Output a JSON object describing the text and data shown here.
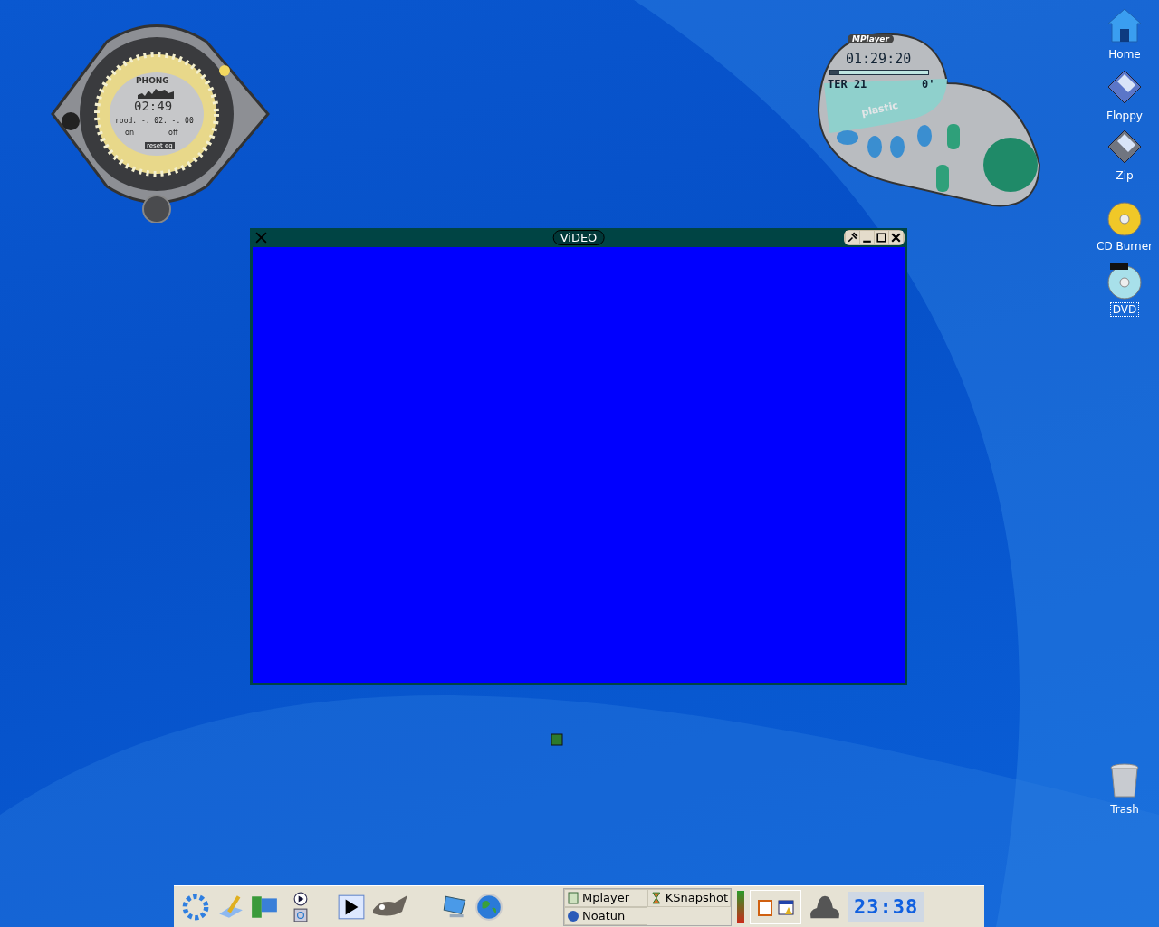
{
  "phong_player": {
    "title": "PHONG",
    "time": "02:49",
    "info": "rood. -. 02. -. 00",
    "on_label": "on",
    "off_label": "off",
    "reset_label": "reset eq"
  },
  "mplayer_skin": {
    "logo": "MPlayer",
    "time": "01:29:20",
    "track": "TER 21",
    "counter": "0'",
    "brand": "plastic",
    "level": 0.09
  },
  "desktop_icons": [
    {
      "label": "Home",
      "kind": "home",
      "selected": false
    },
    {
      "label": "Floppy",
      "kind": "floppy",
      "selected": false
    },
    {
      "label": "Zip",
      "kind": "zip",
      "selected": false
    },
    {
      "label": "CD Burner",
      "kind": "cd",
      "selected": false
    },
    {
      "label": "DVD",
      "kind": "dvd",
      "selected": true
    }
  ],
  "video_window": {
    "title": "ViDEO"
  },
  "trash": {
    "label": "Trash"
  },
  "taskbar": {
    "tasks": [
      {
        "label": "Mplayer",
        "kind": "mplayer"
      },
      {
        "label": "KSnapshot",
        "kind": "ksnapshot"
      },
      {
        "label": "Noatun",
        "kind": "noatun"
      }
    ],
    "clock": "23:38"
  }
}
